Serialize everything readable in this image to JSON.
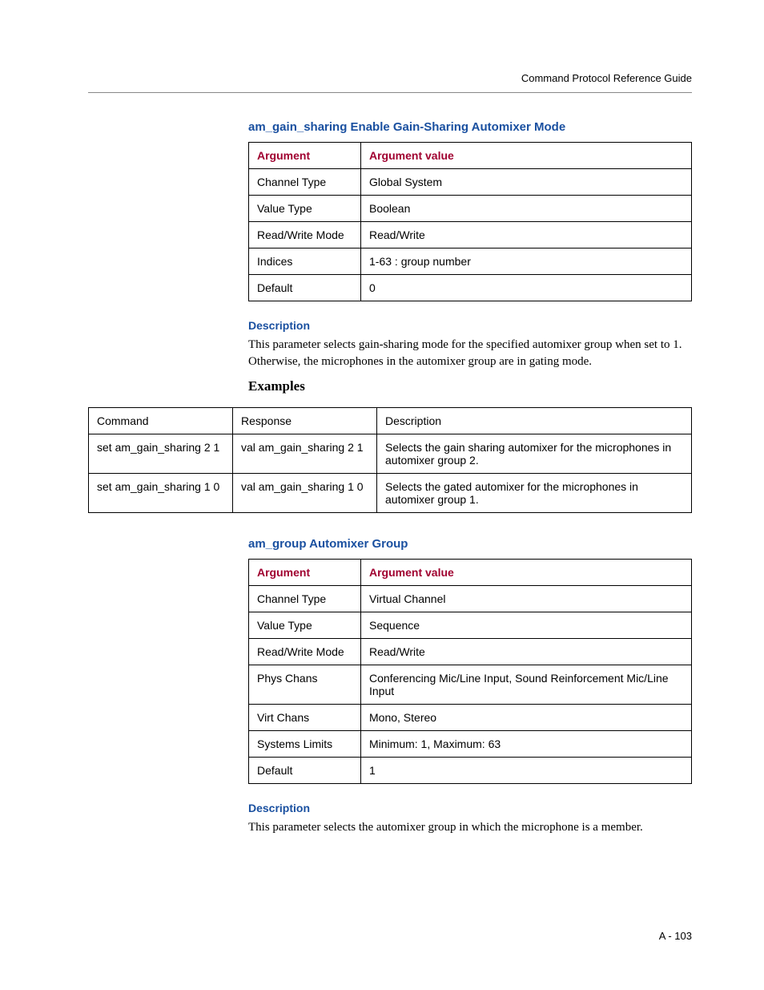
{
  "header": {
    "right": "Command Protocol Reference Guide"
  },
  "sec1": {
    "title": "am_gain_sharing Enable Gain-Sharing Automixer Mode",
    "desc_title": "Description",
    "desc_text": "This parameter selects gain-sharing mode for the specified automixer group when set to 1. Otherwise, the microphones in the automixer group are in gating mode.",
    "arg_table": {
      "h1": "Argument",
      "h2": "Argument value",
      "rows": [
        {
          "a": "Channel Type",
          "v": "Global System"
        },
        {
          "a": "Value Type",
          "v": "Boolean"
        },
        {
          "a": "Read/Write Mode",
          "v": "Read/Write"
        },
        {
          "a": "Indices",
          "v": "1-63 : group number"
        },
        {
          "a": "Default",
          "v": "0"
        }
      ]
    }
  },
  "examples": {
    "heading": "Examples",
    "h1": "Command",
    "h2": "Response",
    "h3": "Description",
    "rows": [
      {
        "c": "set am_gain_sharing 2 1",
        "r": "val am_gain_sharing 2 1",
        "d": "Selects the gain sharing automixer for the microphones in automixer group 2."
      },
      {
        "c": "set am_gain_sharing 1 0",
        "r": "val am_gain_sharing 1 0",
        "d": "Selects the gated automixer for the microphones in automixer group 1."
      }
    ]
  },
  "sec2": {
    "title": "am_group Automixer Group",
    "desc_title": "Description",
    "desc_text": "This parameter selects the automixer group in which the microphone is a member.",
    "arg_table": {
      "h1": "Argument",
      "h2": "Argument value",
      "rows": [
        {
          "a": "Channel Type",
          "v": "Virtual Channel"
        },
        {
          "a": "Value Type",
          "v": "Sequence"
        },
        {
          "a": "Read/Write Mode",
          "v": "Read/Write"
        },
        {
          "a": "Phys Chans",
          "v": "Conferencing Mic/Line Input, Sound Reinforcement Mic/Line Input"
        },
        {
          "a": "Virt Chans",
          "v": "Mono, Stereo"
        },
        {
          "a": "Systems Limits",
          "v": "Minimum: 1, Maximum: 63"
        },
        {
          "a": "Default",
          "v": "1"
        }
      ]
    }
  },
  "footer": {
    "page": "A - 103"
  }
}
